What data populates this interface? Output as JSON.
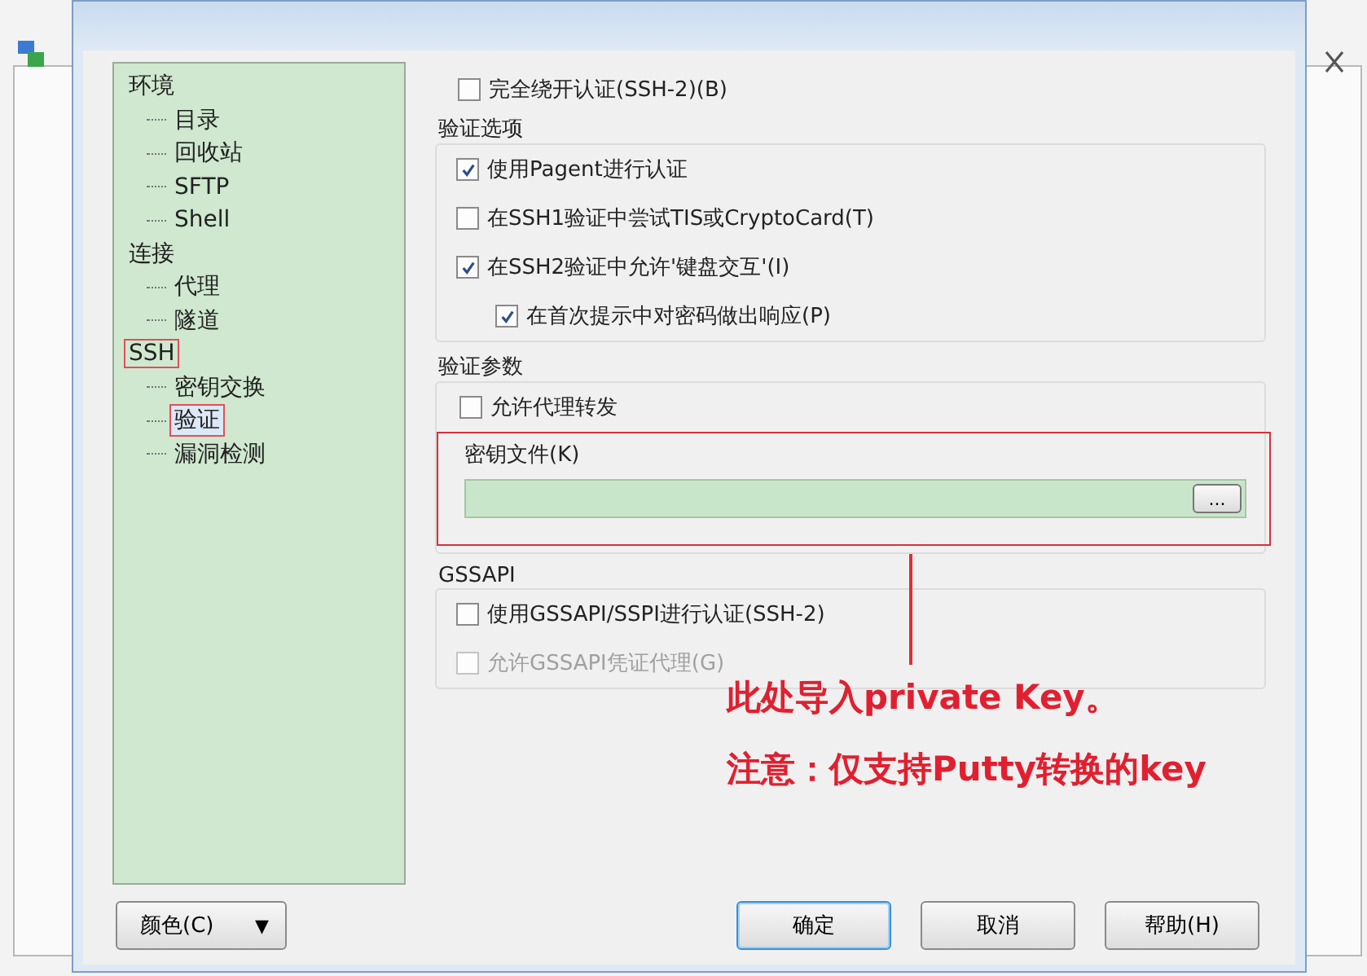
{
  "tree": [
    {
      "label": "环境",
      "selected": false,
      "annotated": false,
      "children": [
        {
          "label": "目录",
          "selected": false,
          "annotated": false
        },
        {
          "label": "回收站",
          "selected": false,
          "annotated": false
        },
        {
          "label": "SFTP",
          "selected": false,
          "annotated": false
        },
        {
          "label": "Shell",
          "selected": false,
          "annotated": false
        }
      ]
    },
    {
      "label": "连接",
      "selected": false,
      "annotated": false,
      "children": [
        {
          "label": "代理",
          "selected": false,
          "annotated": false
        },
        {
          "label": "隧道",
          "selected": false,
          "annotated": false
        }
      ]
    },
    {
      "label": "SSH",
      "selected": false,
      "annotated": true,
      "children": [
        {
          "label": "密钥交换",
          "selected": false,
          "annotated": false
        },
        {
          "label": "验证",
          "selected": true,
          "annotated": true
        },
        {
          "label": "漏洞检测",
          "selected": false,
          "annotated": false
        }
      ]
    }
  ],
  "bypass": {
    "label": "完全绕开认证(SSH-2)(B)",
    "checked": false,
    "disabled": false
  },
  "auth_options": {
    "title": "验证选项",
    "items": [
      {
        "label": "使用Pagent进行认证",
        "checked": true,
        "disabled": false
      },
      {
        "label": "在SSH1验证中尝试TIS或CryptoCard(T)",
        "checked": false,
        "disabled": false
      },
      {
        "label": "在SSH2验证中允许'键盘交互'(I)",
        "checked": true,
        "disabled": false,
        "children": [
          {
            "label": "在首次提示中对密码做出响应(P)",
            "checked": true,
            "disabled": false
          }
        ]
      }
    ]
  },
  "auth_params": {
    "title": "验证参数",
    "items": [
      {
        "label": "允许代理转发",
        "checked": false,
        "disabled": false
      }
    ],
    "key_file": {
      "label": "密钥文件(K)",
      "browse": "...",
      "annotated": true
    }
  },
  "gssapi": {
    "title": "GSSAPI",
    "items": [
      {
        "label": "使用GSSAPI/SSPI进行认证(SSH-2)",
        "checked": false,
        "disabled": false
      },
      {
        "label": "允许GSSAPI凭证代理(G)",
        "checked": false,
        "disabled": true
      }
    ]
  },
  "annotation": {
    "lines": [
      "此处导入private Key。",
      "注意：仅支持Putty转换的key"
    ]
  },
  "buttons": {
    "colors": "颜色(C)",
    "color_caret": "▼",
    "ok": "确定",
    "cancel": "取消",
    "help": "帮助(H)"
  }
}
